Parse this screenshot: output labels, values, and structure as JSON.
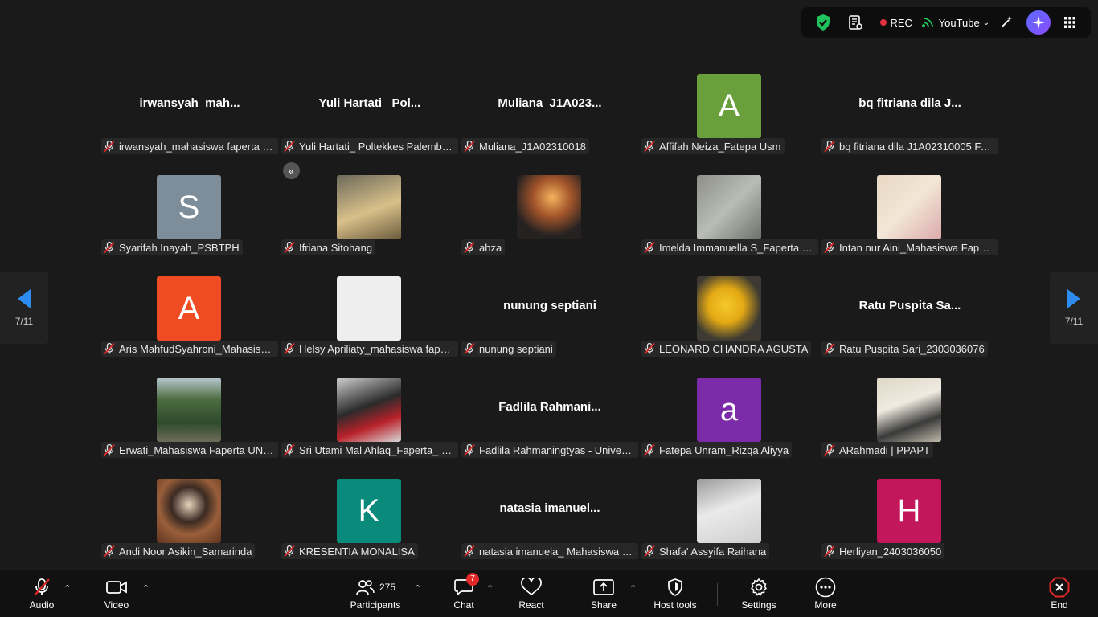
{
  "topbar": {
    "rec_label": "REC",
    "stream_label": "YouTube"
  },
  "colors": {
    "shield": "#21c25e",
    "rec_dot": "#e0303b",
    "badge": "#e02828",
    "end": "#e02828"
  },
  "pager": {
    "left": "7/11",
    "right": "7/11"
  },
  "tiles": [
    {
      "title": "irwansyah_mah...",
      "name": "irwansyah_mahasiswa faperta un..."
    },
    {
      "title": "Yuli  Hartati_ Pol...",
      "name": "Yuli Hartati_ Poltekkes Palembang"
    },
    {
      "title": "Muliana_J1A023...",
      "name": "Muliana_J1A02310018"
    },
    {
      "letter": "A",
      "color": "#6aa03b",
      "name": "Affifah Neiza_Fatepa Usm"
    },
    {
      "title": "bq fitriana dila J...",
      "name": "bq fitriana dila J1A02310005 FAT..."
    },
    {
      "letter": "S",
      "color": "#7d8d99",
      "name": "Syarifah Inayah_PSBTPH"
    },
    {
      "photo": "ph1",
      "name": "Ifriana Sitohang"
    },
    {
      "photo": "ph2",
      "name": "ahza"
    },
    {
      "photo": "ph3",
      "name": "Imelda Immanuella S_Faperta Un..."
    },
    {
      "photo": "ph4",
      "name": "Intan nur Aini_Mahasiswa Fapert..."
    },
    {
      "letter": "A",
      "color": "#f04c23",
      "name": "Aris MahfudSyahroni_Mahasiswa..."
    },
    {
      "photo": "ph5",
      "name": "Helsy Apriliaty_mahasiswa fapert..."
    },
    {
      "title": "nunung septiani",
      "name": "nunung septiani"
    },
    {
      "photo": "ph6",
      "name": "LEONARD CHANDRA AGUSTA"
    },
    {
      "title": "Ratu  Puspita  Sa...",
      "name": "Ratu Puspita Sari_2303036076"
    },
    {
      "photo": "ph7",
      "name": "Erwati_Mahasiswa Faperta UNM..."
    },
    {
      "photo": "ph8",
      "name": "Sri Utami Mal Ahlaq_Faperta_ U..."
    },
    {
      "title": "Fadlila  Rahmani...",
      "name": "Fadlila Rahmaningtyas - Universi..."
    },
    {
      "letter": "a",
      "color": "#7b2aa8",
      "name": "Fatepa Unram_Rizqa Aliyya"
    },
    {
      "photo": "ph9",
      "name": "ARahmadi | PPAPT"
    },
    {
      "photo": "ph10",
      "name": "Andi Noor Asikin_Samarinda"
    },
    {
      "letter": "K",
      "color": "#0a8a7a",
      "name": "KRESENTIA MONALISA"
    },
    {
      "title": "natasia  imanuel...",
      "name": "natasia imanuela_ Mahasiswa fa..."
    },
    {
      "photo": "ph11",
      "name": "Shafa' Assyifa Raihana"
    },
    {
      "letter": "H",
      "color": "#c2185b",
      "name": "Herliyan_2403036050"
    }
  ],
  "toolbar": {
    "audio": "Audio",
    "video": "Video",
    "participants": "Participants",
    "participants_count": "275",
    "chat": "Chat",
    "chat_badge": "7",
    "react": "React",
    "share": "Share",
    "host_tools": "Host tools",
    "settings": "Settings",
    "more": "More",
    "end": "End"
  }
}
